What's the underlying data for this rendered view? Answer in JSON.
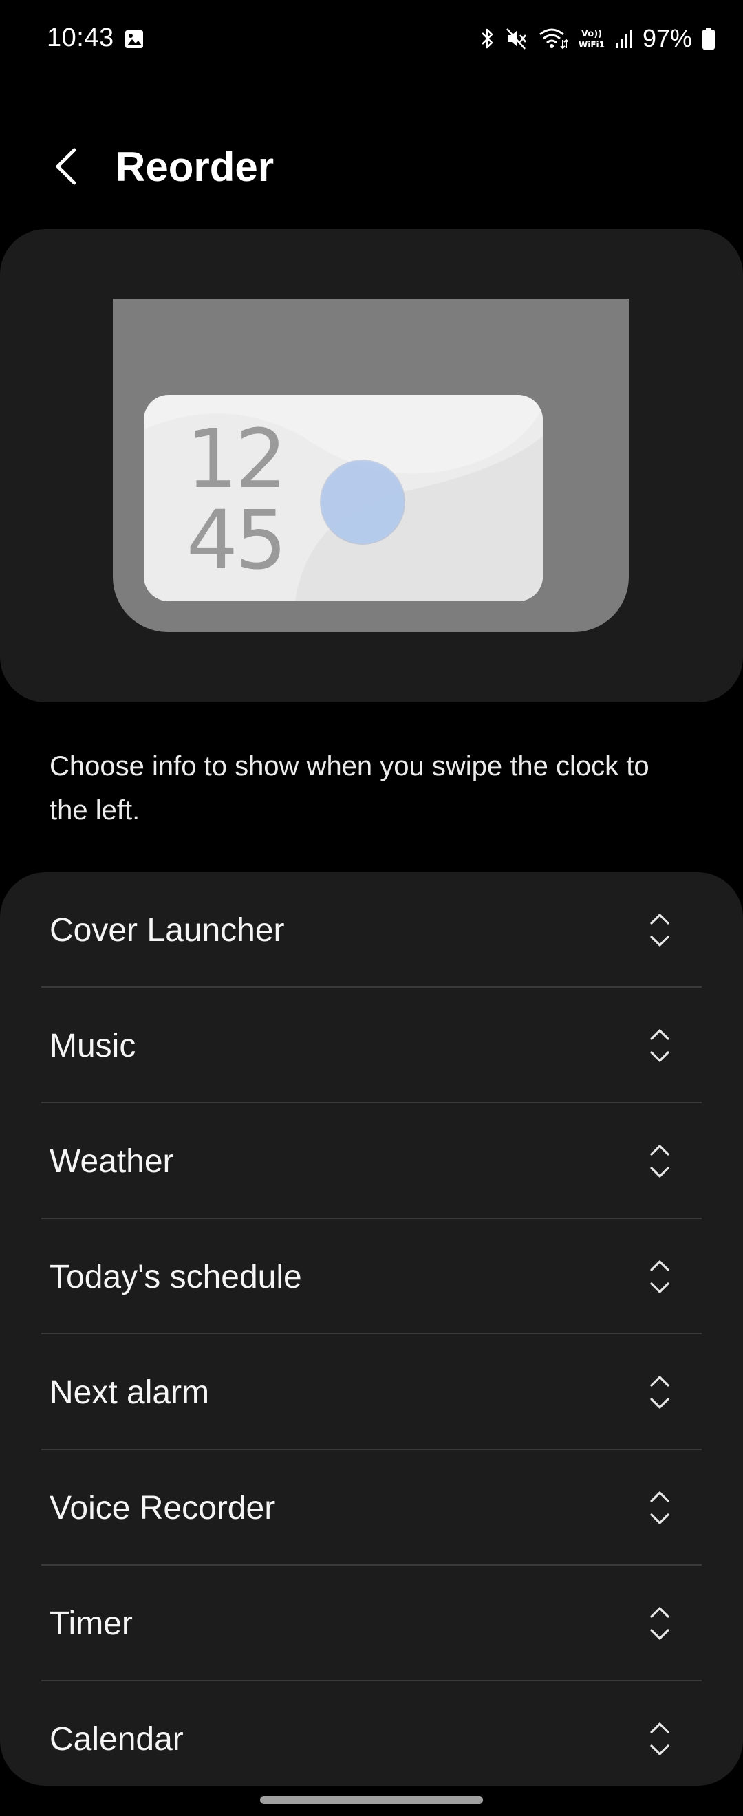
{
  "status_bar": {
    "time": "10:43",
    "battery": "97%",
    "icons": [
      "gallery-icon",
      "bluetooth-icon",
      "mute-icon",
      "wifi-icon",
      "vowifi-icon",
      "signal-icon",
      "battery-icon"
    ],
    "vowifi_label_top": "Vo))",
    "vowifi_label_bottom": "WiFi1"
  },
  "header": {
    "title": "Reorder",
    "back_icon": "back-arrow-icon"
  },
  "preview": {
    "clock_hour": "12",
    "clock_minute": "45"
  },
  "description": "Choose info to show when you swipe the clock to the left.",
  "items": [
    {
      "label": "Cover Launcher"
    },
    {
      "label": "Music"
    },
    {
      "label": "Weather"
    },
    {
      "label": "Today's schedule"
    },
    {
      "label": "Next alarm"
    },
    {
      "label": "Voice Recorder"
    },
    {
      "label": "Timer"
    },
    {
      "label": "Calendar"
    }
  ],
  "colors": {
    "background": "#000000",
    "card": "#1c1c1c",
    "divider": "#3a3a3a",
    "text": "#ffffff",
    "touch_dot": "#b2c9ec"
  }
}
